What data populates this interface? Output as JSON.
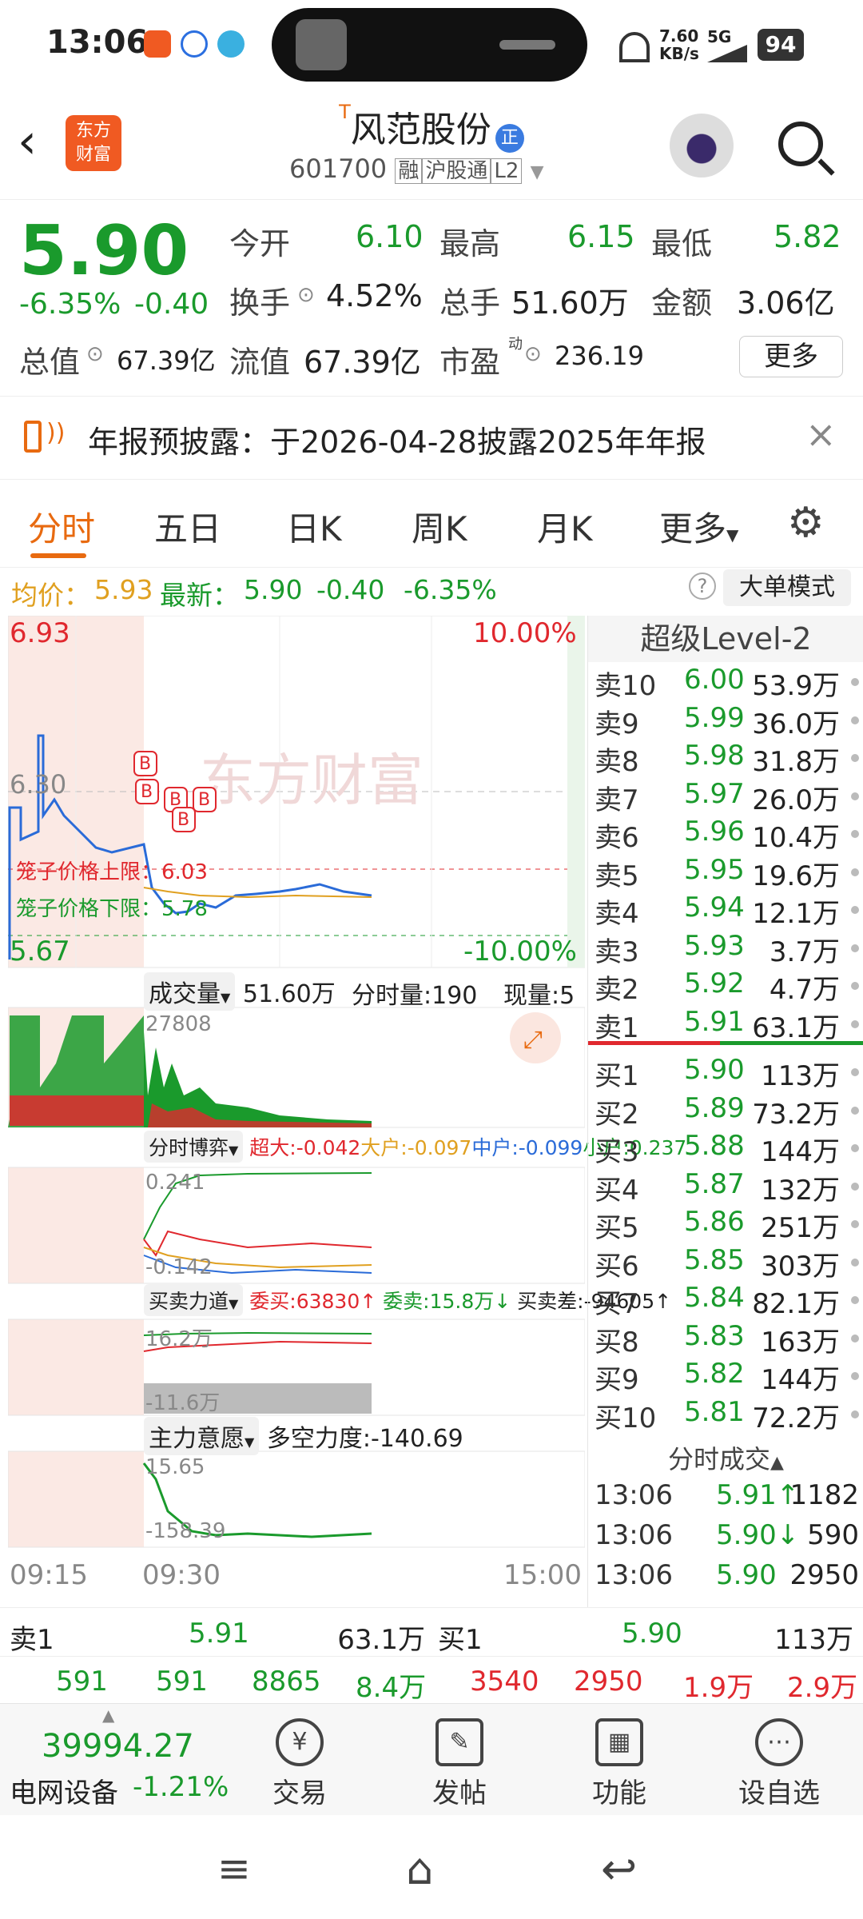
{
  "status": {
    "time": "13:06",
    "speed": "7.60",
    "speed_unit": "KB/s",
    "net": "5G",
    "battery": "94"
  },
  "header": {
    "stock_name": "风范股份",
    "name_prefix": "T",
    "badge": "正",
    "code": "601700",
    "tags": [
      "融",
      "沪股通",
      "L2"
    ]
  },
  "quote": {
    "price": "5.90",
    "change_pct": "-6.35%",
    "change": "-0.40",
    "open_label": "今开",
    "open": "6.10",
    "high_label": "最高",
    "high": "6.15",
    "low_label": "最低",
    "low": "5.82",
    "turnover_label": "换手",
    "turnover": "4.52%",
    "volume_label": "总手",
    "volume": "51.60万",
    "amount_label": "金额",
    "amount": "3.06亿",
    "mcap_label": "总值",
    "mcap": "67.39亿",
    "float_label": "流值",
    "float": "67.39亿",
    "pe_label": "市盈",
    "pe_sup": "动",
    "pe": "236.19",
    "more": "更多"
  },
  "notice": {
    "text": "年报预披露：于2026-04-28披露2025年年报"
  },
  "tabs": [
    "分时",
    "五日",
    "日K",
    "周K",
    "月K",
    "更多"
  ],
  "avg": {
    "avg_label": "均价：",
    "avg": "5.93",
    "latest_label": "最新：",
    "latest": "5.90",
    "chg": "-0.40",
    "pct": "-6.35%",
    "mode": "大单模式"
  },
  "chart": {
    "top_price": "6.93",
    "top_pct": "10.00%",
    "mid_price": "6.30",
    "bot_price": "5.67",
    "bot_pct": "-10.00%",
    "upper_label": "笼子价格上限：6.03",
    "lower_label": "笼子价格下限：5.78",
    "watermark": "东方财富",
    "vol_btn": "成交量",
    "vol_total": "51.60万",
    "tick_vol": "分时量:190",
    "cur_vol": "现量:5",
    "vol_max": "27808",
    "game_btn": "分时博弈",
    "game_super": "超大:-0.042",
    "game_big": "大户:-0.097",
    "game_mid": "中户:-0.099",
    "game_small": "小户:0.237",
    "game_hi": "0.241",
    "game_lo": "-0.142",
    "bs_btn": "买卖力道",
    "bs_buy": "委买:63830",
    "bs_sell": "委卖:15.8万",
    "bs_diff": "买卖差:-94605",
    "bs_hi": "16.2万",
    "bs_lo": "-11.6万",
    "main_btn": "主力意愿",
    "main_val": "多空力度:-140.69",
    "main_hi": "15.65",
    "main_lo": "-158.39",
    "t1": "09:15",
    "t2": "09:30",
    "t3": "15:00"
  },
  "orderbook": {
    "title": "超级Level-2",
    "asks": [
      {
        "l": "卖10",
        "p": "6.00",
        "v": "53.9万"
      },
      {
        "l": "卖9",
        "p": "5.99",
        "v": "36.0万"
      },
      {
        "l": "卖8",
        "p": "5.98",
        "v": "31.8万"
      },
      {
        "l": "卖7",
        "p": "5.97",
        "v": "26.0万"
      },
      {
        "l": "卖6",
        "p": "5.96",
        "v": "10.4万"
      },
      {
        "l": "卖5",
        "p": "5.95",
        "v": "19.6万"
      },
      {
        "l": "卖4",
        "p": "5.94",
        "v": "12.1万"
      },
      {
        "l": "卖3",
        "p": "5.93",
        "v": "3.7万"
      },
      {
        "l": "卖2",
        "p": "5.92",
        "v": "4.7万"
      },
      {
        "l": "卖1",
        "p": "5.91",
        "v": "63.1万"
      }
    ],
    "bids": [
      {
        "l": "买1",
        "p": "5.90",
        "v": "113万"
      },
      {
        "l": "买2",
        "p": "5.89",
        "v": "73.2万"
      },
      {
        "l": "买3",
        "p": "5.88",
        "v": "144万"
      },
      {
        "l": "买4",
        "p": "5.87",
        "v": "132万"
      },
      {
        "l": "买5",
        "p": "5.86",
        "v": "251万"
      },
      {
        "l": "买6",
        "p": "5.85",
        "v": "303万"
      },
      {
        "l": "买7",
        "p": "5.84",
        "v": "82.1万"
      },
      {
        "l": "买8",
        "p": "5.83",
        "v": "163万"
      },
      {
        "l": "买9",
        "p": "5.82",
        "v": "144万"
      },
      {
        "l": "买10",
        "p": "5.81",
        "v": "72.2万"
      }
    ],
    "ticks_title": "分时成交",
    "ticks": [
      {
        "t": "13:06",
        "p": "5.91↑",
        "v": "1182"
      },
      {
        "t": "13:06",
        "p": "5.90↓",
        "v": "590"
      },
      {
        "t": "13:06",
        "p": "5.90",
        "v": "2950"
      }
    ]
  },
  "bottom": {
    "ask_label": "卖1",
    "ask_p": "5.91",
    "ask_v": "63.1万",
    "bid_label": "买1",
    "bid_p": "5.90",
    "bid_v": "113万",
    "ask_row": [
      "591",
      "591",
      "8865",
      "8.4万"
    ],
    "bid_row": [
      "3540",
      "2950",
      "1.9万",
      "2.9万"
    ]
  },
  "nav": {
    "index_val": "39994.27",
    "index_name": "电网设备",
    "index_pct": "-1.21%",
    "trade": "交易",
    "post": "发帖",
    "func": "功能",
    "watch": "设自选"
  }
}
